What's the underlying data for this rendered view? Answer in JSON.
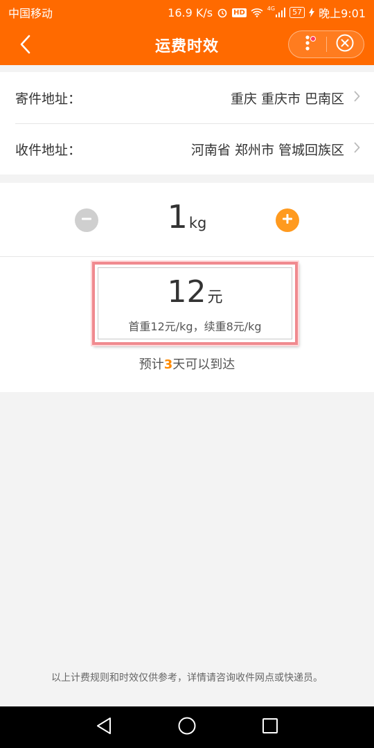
{
  "status_bar": {
    "carrier": "中国移动",
    "speed": "16.9 K/s",
    "hd_label": "HD",
    "network_label": "4G",
    "battery": "57",
    "time": "晚上9:01",
    "icons": [
      "alarm-icon",
      "hd-icon",
      "wifi-icon",
      "signal-icon",
      "battery-icon",
      "charging-icon"
    ]
  },
  "nav": {
    "title": "运费时效",
    "back_icon": "chevron-left-icon",
    "more_icon": "more-dots-icon",
    "close_icon": "close-circle-icon"
  },
  "addresses": {
    "sender": {
      "label": "寄件地址：",
      "value": "重庆 重庆市 巴南区"
    },
    "receiver": {
      "label": "收件地址：",
      "value": "河南省 郑州市 管城回族区"
    }
  },
  "weight": {
    "value": "1",
    "unit": "kg"
  },
  "price": {
    "value": "12",
    "unit": "元",
    "detail": "首重12元/kg，续重8元/kg"
  },
  "eta": {
    "prefix": "预计",
    "days": "3",
    "suffix": "天可以到达"
  },
  "disclaimer": "以上计费规则和时效仅供参考，详情请咨询收件网点或快递员。",
  "android_nav": [
    "back-triangle-icon",
    "home-circle-icon",
    "recents-square-icon"
  ],
  "colors": {
    "brand": "#ff6a00",
    "plus": "#ff9a1f",
    "minus": "#cfcfcf",
    "highlight_border": "#f08a8f",
    "eta_accent": "#ff8a00"
  }
}
